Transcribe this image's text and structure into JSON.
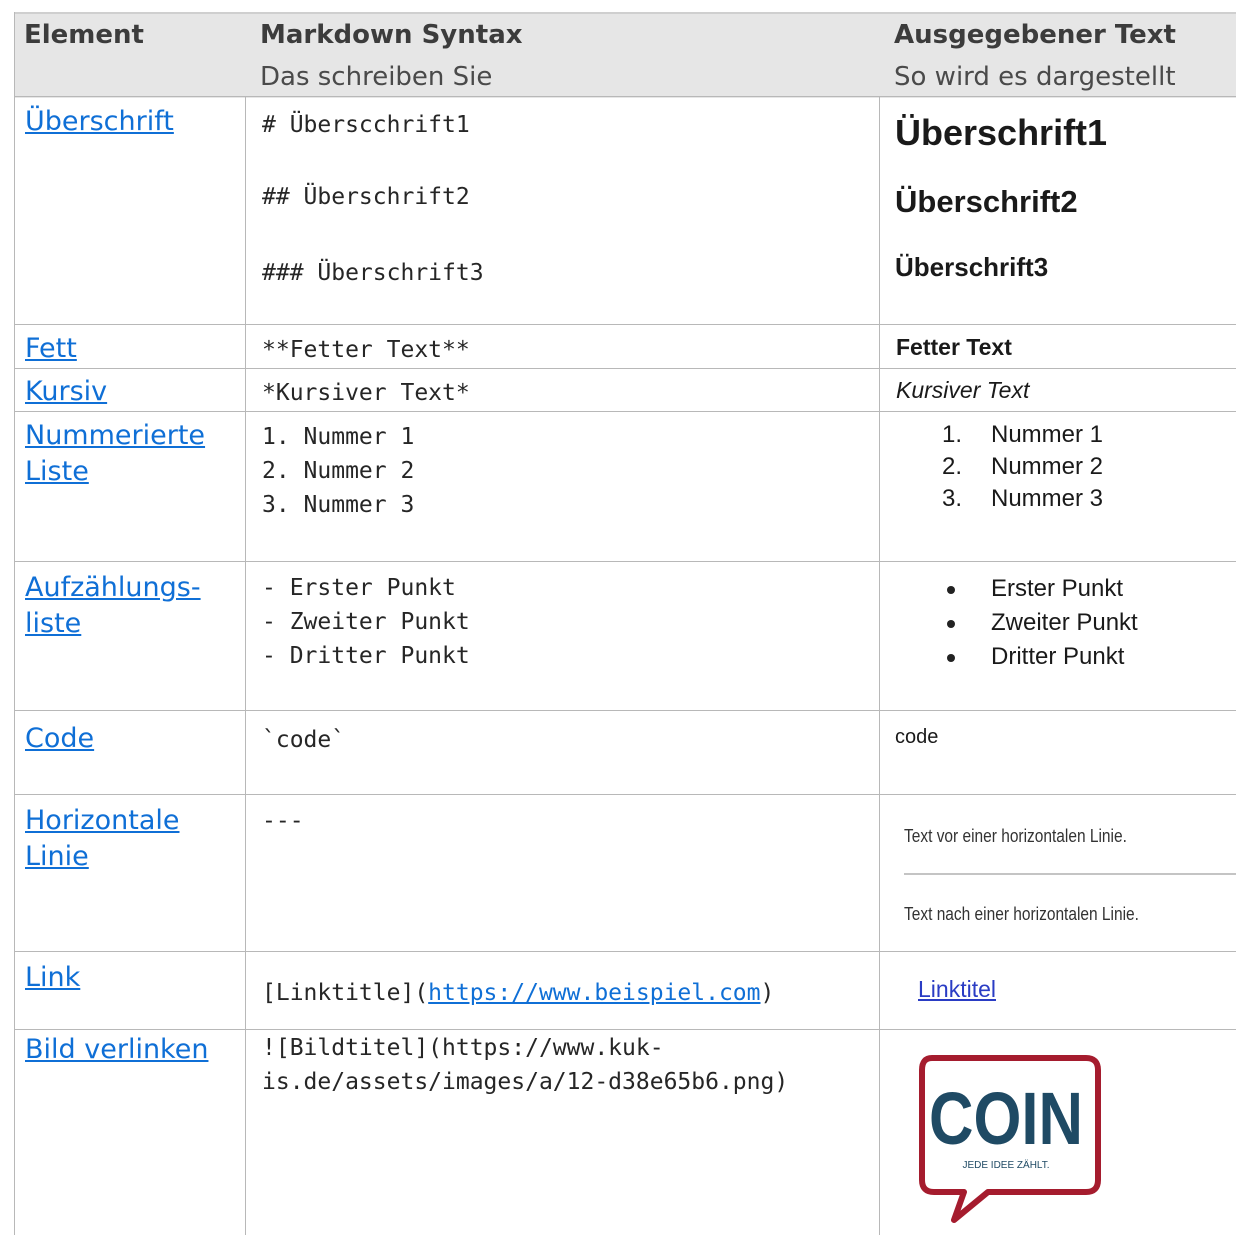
{
  "headers": {
    "element": "Element",
    "syntax": "Markdown Syntax",
    "syntax_sub": "Das schreiben Sie",
    "output": "Ausgegebener Text",
    "output_sub": "So wird es dargestellt"
  },
  "rows": {
    "heading": {
      "element": "Überschrift",
      "syntax": [
        "# Überscchrift1",
        "## Überschrift2",
        "### Überschrift3"
      ],
      "output": [
        "Überschrift1",
        "Überschrift2",
        "Überschrift3"
      ]
    },
    "bold": {
      "element": "Fett",
      "syntax": "**Fetter Text**",
      "output": "Fetter Text"
    },
    "italic": {
      "element": "Kursiv",
      "syntax": "*Kursiver Text*",
      "output": "Kursiver Text"
    },
    "numbered": {
      "element_1": "Nummerierte",
      "element_2": "Liste",
      "syntax": [
        "1. Nummer 1",
        "2. Nummer 2",
        "3. Nummer 3"
      ],
      "markers": [
        "1.",
        "2.",
        "3."
      ],
      "output": [
        "Nummer 1",
        "Nummer 2",
        "Nummer 3"
      ]
    },
    "bullet": {
      "element_1": "Aufzählungs-",
      "element_2": "liste",
      "syntax": [
        "- Erster Punkt",
        "- Zweiter Punkt",
        "- Dritter Punkt"
      ],
      "output": [
        "Erster Punkt",
        "Zweiter Punkt",
        "Dritter Punkt"
      ]
    },
    "code": {
      "element": "Code",
      "syntax": "`code`",
      "output": "code"
    },
    "hr": {
      "element_1": "Horizontale",
      "element_2": "Linie",
      "syntax": "---",
      "output_before": "Text vor einer horizontalen Linie.",
      "output_after": "Text nach einer horizontalen Linie."
    },
    "link": {
      "element": "Link",
      "syntax_prefix": "[Linktitle](",
      "syntax_url": "https://www.beispiel.com",
      "syntax_suffix": ")",
      "output": "Linktitel"
    },
    "image": {
      "element": "Bild verlinken",
      "syntax_1": "![Bildtitel](https://www.kuk-",
      "syntax_2": "is.de/assets/images/a/12-d38e65b6.png)",
      "logo_text": "COIN",
      "logo_tagline": "JEDE IDEE ZÄHLT."
    }
  },
  "colors": {
    "link": "#0f6fd6",
    "header_bg": "#e6e6e6",
    "logo_red": "#a51c2e",
    "logo_blue": "#1f4a64"
  },
  "icons": {
    "logo": "coin-speech-bubble-logo"
  }
}
